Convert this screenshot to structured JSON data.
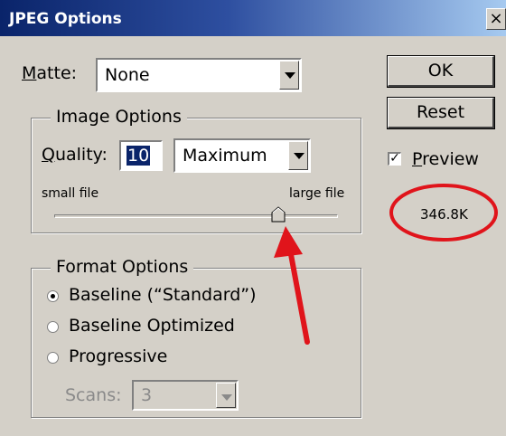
{
  "window": {
    "title": "JPEG Options",
    "close_label": "×"
  },
  "matte": {
    "label": "Matte:",
    "value": "None"
  },
  "image_options": {
    "legend": "Image Options",
    "quality_label": "Quality:",
    "quality_value": "10",
    "quality_preset": "Maximum",
    "small_file_label": "small file",
    "large_file_label": "large file",
    "slider_value": 10,
    "slider_max": 12
  },
  "format_options": {
    "legend": "Format Options",
    "options": [
      {
        "label": "Baseline (“Standard”)",
        "selected": true
      },
      {
        "label": "Baseline Optimized",
        "selected": false
      },
      {
        "label": "Progressive",
        "selected": false
      }
    ],
    "scans_label": "Scans:",
    "scans_value": "3"
  },
  "buttons": {
    "ok": "OK",
    "reset": "Reset"
  },
  "preview": {
    "label": "Preview",
    "checked": true,
    "check_mark": "✓",
    "file_size": "346.8K"
  },
  "colors": {
    "annotation": "#e0141b",
    "title_bar": "#0a246a",
    "selection": "#0a246a"
  },
  "icons": [
    "close-icon",
    "chevron-down-icon",
    "slider-thumb-icon",
    "check-icon",
    "radio-icon",
    "annotation-arrow",
    "annotation-circle"
  ]
}
